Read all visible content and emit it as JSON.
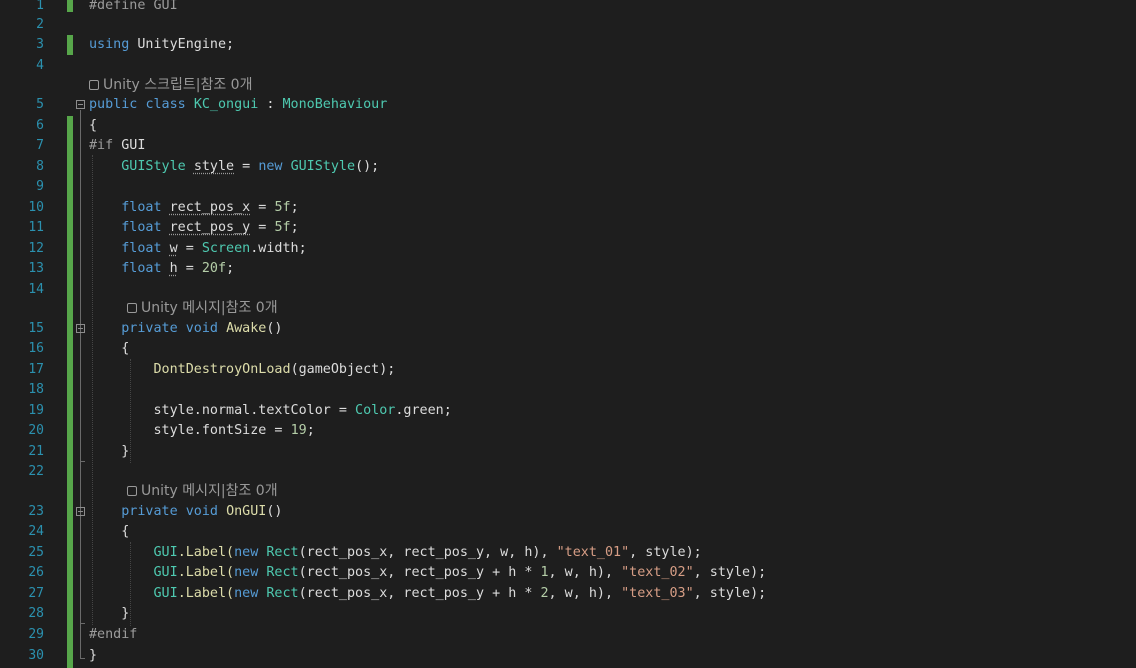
{
  "editor": {
    "line_numbers": [
      "1",
      "2",
      "3",
      "4",
      "5",
      "6",
      "7",
      "8",
      "9",
      "10",
      "11",
      "12",
      "13",
      "14",
      "15",
      "16",
      "17",
      "18",
      "19",
      "20",
      "21",
      "22",
      "23",
      "24",
      "25",
      "26",
      "27",
      "28",
      "29",
      "30"
    ],
    "code": {
      "l1": "#define GUI",
      "l3_kw": "using",
      "l3_rest": " UnityEngine;",
      "lens_class": "Unity 스크립트|참조 0개",
      "l5_kw1": "public",
      "l5_kw2": "class",
      "l5_name": "KC_ongui",
      "l5_colon": " : ",
      "l5_base": "MonoBehaviour",
      "l6": "{",
      "l7_pp": "#if",
      "l7_sym": " GUI",
      "l8_type": "GUIStyle",
      "l8_var": "style",
      "l8_eq": " = ",
      "l8_new": "new",
      "l8_ctor": "GUIStyle",
      "l8_end": "();",
      "l10_kw": "float",
      "l10_var": "rect_pos_x",
      "l10_eq": " = ",
      "l10_num": "5f",
      "l10_end": ";",
      "l11_kw": "float",
      "l11_var": "rect_pos_y",
      "l11_eq": " = ",
      "l11_num": "5f",
      "l11_end": ";",
      "l12_kw": "float",
      "l12_var": "w",
      "l12_eq": " = ",
      "l12_type": "Screen",
      "l12_end": ".width;",
      "l13_kw": "float",
      "l13_var": "h",
      "l13_eq": " = ",
      "l13_num": "20f",
      "l13_end": ";",
      "lens_awake": "Unity 메시지|참조 0개",
      "l15_kw1": "private",
      "l15_kw2": "void",
      "l15_fn": "Awake",
      "l15_end": "()",
      "l16": "{",
      "l17_fn": "DontDestroyOnLoad",
      "l17_end": "(gameObject);",
      "l19_start": "style.normal.textColor = ",
      "l19_type": "Color",
      "l19_end": ".green;",
      "l20_start": "style.fontSize = ",
      "l20_num": "19",
      "l20_end": ";",
      "l21": "}",
      "lens_ongui": "Unity 메시지|참조 0개",
      "l23_kw1": "private",
      "l23_kw2": "void",
      "l23_fn": "OnGUI",
      "l23_end": "()",
      "l24": "{",
      "label_lines": [
        {
          "gui": "GUI",
          "label": ".Label(",
          "new": "new",
          "rect": "Rect",
          "args": "(rect_pos_x, rect_pos_y, w, h), ",
          "str": "\"text_01\"",
          "end": ", style);"
        },
        {
          "gui": "GUI",
          "label": ".Label(",
          "new": "new",
          "rect": "Rect",
          "args1": "(rect_pos_x, rect_pos_y + h * ",
          "num": "1",
          "args2": ", w, h), ",
          "str": "\"text_02\"",
          "end": ", style);"
        },
        {
          "gui": "GUI",
          "label": ".Label(",
          "new": "new",
          "rect": "Rect",
          "args1": "(rect_pos_x, rect_pos_y + h * ",
          "num": "2",
          "args2": ", w, h), ",
          "str": "\"text_03\"",
          "end": ", style);"
        }
      ],
      "l28": "}",
      "l29": "#endif",
      "l30": "}"
    },
    "colors": {
      "background": "#1e1e1e",
      "line_number": "#2b91af",
      "keyword": "#569cd6",
      "type": "#4ec9b0",
      "function": "#dcdcaa",
      "number": "#b5cea8",
      "string": "#d69d85",
      "change_bar": "#57a64a"
    }
  }
}
